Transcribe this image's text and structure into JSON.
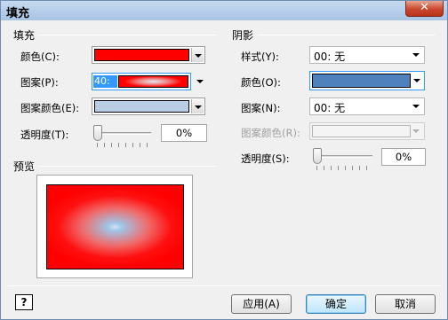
{
  "title": "填充",
  "close_glyph": "✕",
  "fill": {
    "group": "填充",
    "color_label": "颜色(C):",
    "color_value": "#ff0000",
    "pattern_label": "图案(P):",
    "pattern_number": "40:",
    "pattern_color_label": "图案颜色(E):",
    "pattern_color_value": "#b9cde5",
    "transparency_label": "透明度(T):",
    "transparency_value": "0%"
  },
  "preview": {
    "group": "预览"
  },
  "shadow": {
    "group": "阴影",
    "style_label": "样式(Y):",
    "style_value": "00: 无",
    "color_label": "颜色(O):",
    "color_value": "#4f81bd",
    "pattern_label": "图案(N):",
    "pattern_value": "00: 无",
    "pattern_color_label": "图案颜色(R):",
    "transparency_label": "透明度(S):",
    "transparency_value": "0%"
  },
  "buttons": {
    "help": "?",
    "apply": "应用(A)",
    "ok": "确定",
    "cancel": "取消"
  }
}
